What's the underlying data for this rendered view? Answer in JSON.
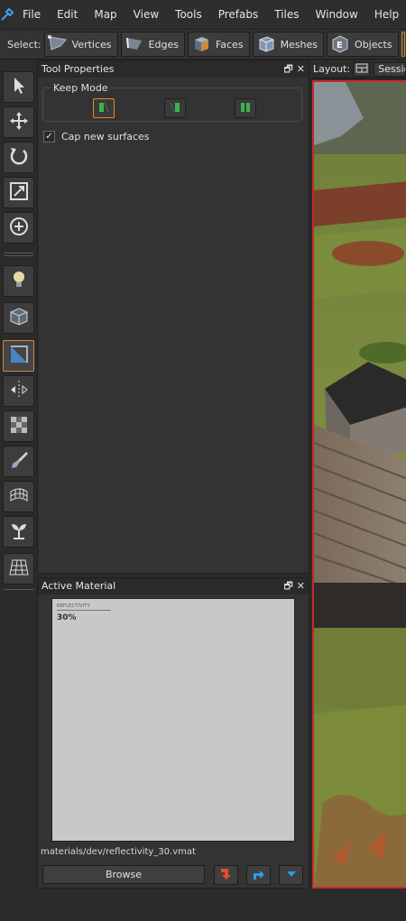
{
  "menubar": {
    "items": [
      "File",
      "Edit",
      "Map",
      "View",
      "Tools",
      "Prefabs",
      "Tiles",
      "Window",
      "Help"
    ]
  },
  "select_toolbar": {
    "label": "Select:",
    "buttons": [
      {
        "label": "Vertices",
        "icon": "vertices-icon"
      },
      {
        "label": "Edges",
        "icon": "edges-icon"
      },
      {
        "label": "Faces",
        "icon": "faces-icon"
      },
      {
        "label": "Meshes",
        "icon": "meshes-icon"
      },
      {
        "label": "Objects",
        "icon": "objects-icon"
      }
    ]
  },
  "left_toolbar": {
    "tools": [
      "select-arrow-icon",
      "move-icon",
      "rotate-icon",
      "scale-icon",
      "pivot-icon",
      "light-icon",
      "block-icon",
      "clipping-icon",
      "mirror-icon",
      "texture-icon",
      "paint-icon",
      "surface-icon",
      "foliage-icon",
      "grid-icon"
    ],
    "active_tool": "clipping-icon"
  },
  "tool_properties": {
    "title": "Tool Properties",
    "keep_mode_label": "Keep Mode",
    "cap_label": "Cap new surfaces",
    "cap_checked": true,
    "keep_mode_active": 0
  },
  "active_material": {
    "title": "Active Material",
    "swatch_title": "REFLECTIVITY",
    "swatch_value": "30%",
    "path": "materials/dev/reflectivity_30.vmat",
    "browse_label": "Browse"
  },
  "viewport": {
    "layout_label": "Layout:",
    "session_label": "Sessio"
  },
  "colors": {
    "accent_orange": "#e08a2c",
    "viewport_border": "#c82a2a"
  }
}
